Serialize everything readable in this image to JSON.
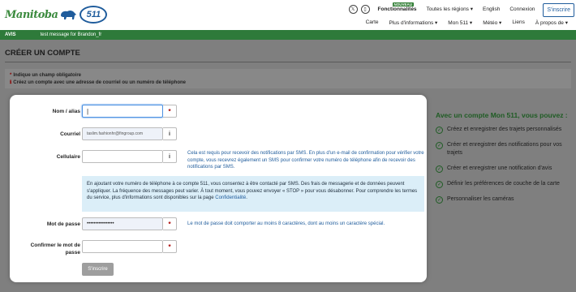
{
  "header": {
    "logo_text": "Manitoba",
    "logo_badge": "511",
    "nouveau_badge": "NOUVEAU",
    "top_links": [
      "Fonctionnalités",
      "Toutes les régions ▾",
      "English",
      "Connexion"
    ],
    "signup_label": "S'inscrire",
    "sub_links": [
      "Carte",
      "Plus d'informations ▾",
      "Mon 511 ▾",
      "Météo ▾",
      "Liens",
      "À propos de ▾"
    ]
  },
  "alert": {
    "label": "AVIS",
    "message": "test message for Brandon_fr"
  },
  "page": {
    "title": "CRÉER UN COMPTE",
    "notice_required": "Indique un champ obligatoire",
    "notice_info": "Créez un compte avec une adresse de courriel ou un numéro de téléphone"
  },
  "form": {
    "name_label": "Nom / alias",
    "email_label": "Courriel",
    "email_value": "taslim.fashionhr@fingroup.com",
    "cell_label": "Cellulaire",
    "cell_help": "Cela est requis pour recevoir des notifications par SMS. En plus d'un e-mail de confirmation pour vérifier votre compte, vous recevrez également un SMS pour confirmer votre numéro de téléphone afin de recevoir des notifications par SMS.",
    "sms_info": "En ajoutant votre numéro de téléphone à ce compte 511, vous consentez à être contacté par SMS. Des frais de messagerie et de données peuvent s'appliquer. La fréquence des messages peut varier. À tout moment, vous pouvez envoyer « STOP » pour vous désabonner. Pour comprendre les termes du service, plus d'informations sont disponibles sur la page ",
    "sms_link": "Confidentialité",
    "password_label": "Mot de passe",
    "password_value": "••••••••••••••••",
    "password_help": "Le mot de passe doit comporter au moins 8 caractères, dont au moins un caractère spécial.",
    "confirm_label_1": "Confirmer le mot de",
    "confirm_label_2": "passe",
    "submit_label": "S'inscrire",
    "required_mark": "*",
    "info_mark": "i"
  },
  "benefits": {
    "title": "Avec un compte Mon 511, vous pouvez :",
    "items": [
      "Créez et enregistrer des trajets personnalisés",
      "Créer et enregistrer des notifications pour vos trajets",
      "Créer et enregistrer une notification d'avis",
      "Définir les préférences de couche de la carte",
      "Personnaliser les caméras"
    ]
  },
  "colors": {
    "alert_green": "#2e7a3a",
    "brand_blue": "#1f5c9c",
    "required_red": "#8b0000",
    "info_bg": "#dbeef8"
  }
}
